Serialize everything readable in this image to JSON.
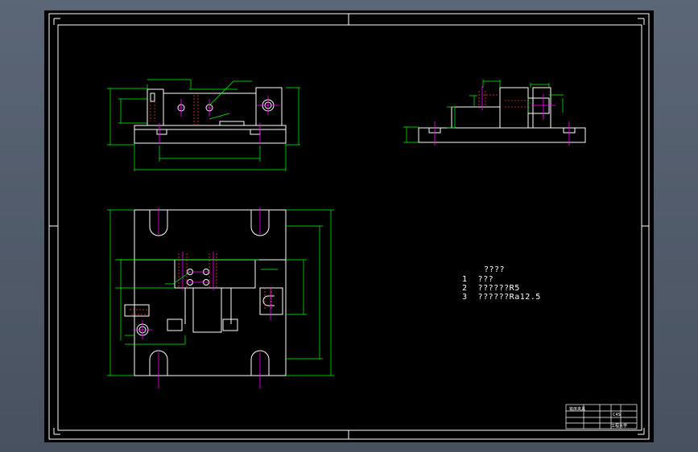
{
  "colors": {
    "background_outer": "#4a5563",
    "canvas": "#000000",
    "frame": "#ffffff",
    "part_outline": "#ffffff",
    "dimension": "#00ff00",
    "centerline": "#ff00ff",
    "hidden": "#ff3030"
  },
  "notes": {
    "title": "????",
    "items": [
      "1  ???",
      "2  ??????R5",
      "3  ??????Ra12.5"
    ]
  },
  "title_block": {
    "drawing_name": "铣床夹具",
    "code": "C4S",
    "company": "工程大学"
  }
}
